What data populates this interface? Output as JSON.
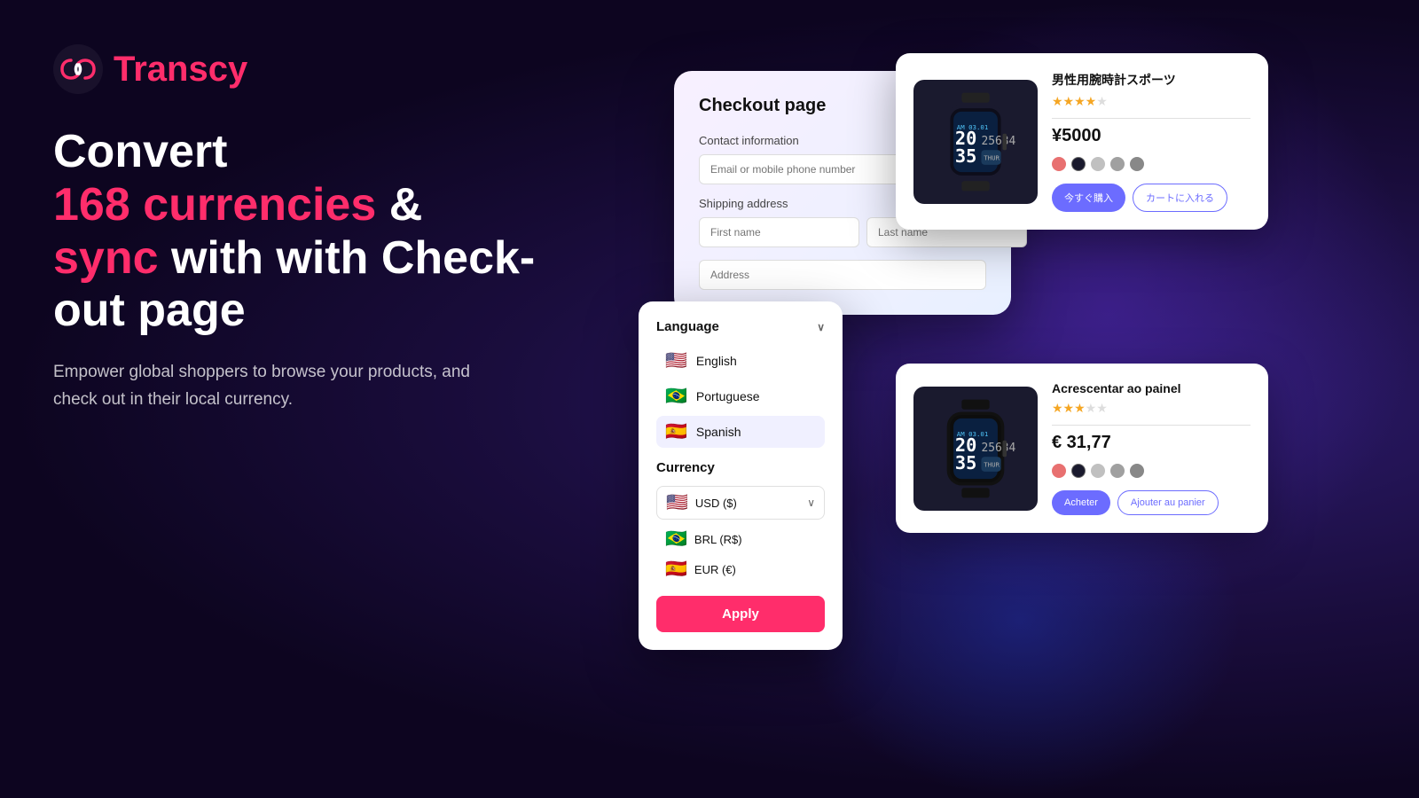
{
  "brand": {
    "name_part1": "Trans",
    "name_part2": "cy"
  },
  "headline": {
    "line1": "Convert",
    "highlight1": "168 currencies",
    "line2": "&",
    "highlight2": "sync",
    "line3": "with Check-",
    "line4": "out page"
  },
  "subtext": "Empower global shoppers to browse your products, and check out in their local currency.",
  "checkout_card": {
    "title": "Checkout page",
    "contact_label": "Contact information",
    "email_placeholder": "Email or mobile phone number",
    "shipping_label": "Shipping address",
    "first_name_placeholder": "First name",
    "last_name_placeholder": "Last name",
    "address_placeholder": "Address"
  },
  "product_top": {
    "title": "男性用腕時計スポーツ",
    "stars": "★★★★☆",
    "price": "¥5000",
    "colors": [
      "#e87070",
      "#1a1a2e",
      "#c0c0c0",
      "#a0a0a0",
      "#888888"
    ],
    "btn1": "今すぐ購入",
    "btn2": "カートに入れる"
  },
  "product_bottom": {
    "title": "Acrescentar ao painel",
    "stars": "★★★☆☆",
    "price": "€ 31,77",
    "colors": [
      "#e87070",
      "#1a1a2e",
      "#c0c0c0",
      "#a0a0a0",
      "#888888"
    ],
    "btn1": "Acheter",
    "btn2": "Ajouter au panier"
  },
  "language_popup": {
    "language_label": "Language",
    "chevron": "∨",
    "languages": [
      {
        "flag": "🇺🇸",
        "name": "English",
        "selected": false
      },
      {
        "flag": "🇧🇷",
        "name": "Portuguese",
        "selected": false
      },
      {
        "flag": "🇪🇸",
        "name": "Spanish",
        "selected": true
      }
    ],
    "currency_label": "Currency",
    "currency_selected": "USD ($)",
    "currencies": [
      {
        "flag": "🇺🇸",
        "name": "USD ($)",
        "is_select": true
      },
      {
        "flag": "🇧🇷",
        "name": "BRL (R$)"
      },
      {
        "flag": "🇪🇸",
        "name": "EUR (€)"
      }
    ],
    "apply_btn": "Apply"
  }
}
